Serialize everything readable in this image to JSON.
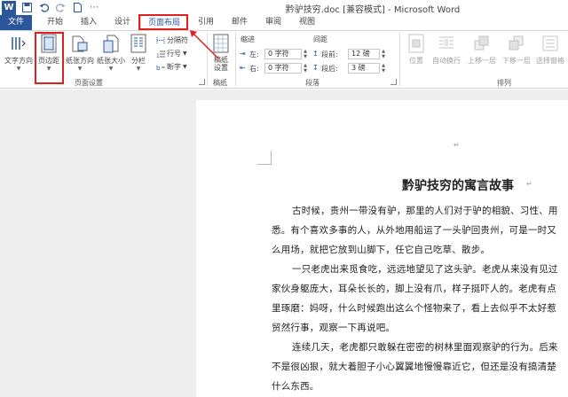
{
  "window": {
    "title": "黔驴技穷.doc [兼容模式] - Microsoft Word"
  },
  "qat": {
    "app_icon": "W",
    "more": "⋯"
  },
  "tabs": [
    "文件",
    "开始",
    "插入",
    "设计",
    "页面布局",
    "引用",
    "邮件",
    "审阅",
    "视图"
  ],
  "active_tab": "页面布局",
  "ribbon": {
    "page_setup": {
      "label": "页面设置",
      "text_direction": "文字方向",
      "margins": "页边距",
      "orientation": "纸张方向",
      "size": "纸张大小",
      "columns": "分栏",
      "breaks": "分隔符",
      "line_numbers": "行号",
      "hyphenation": "断字"
    },
    "draft": {
      "label": "稿纸",
      "settings": "稿纸\n设置"
    },
    "paragraph": {
      "label": "段落",
      "indent_header": "缩进",
      "spacing_header": "间距",
      "left_label": "左:",
      "left_value": "0 字符",
      "right_label": "右:",
      "right_value": "0 字符",
      "before_label": "段前:",
      "before_value": "12 磅",
      "after_label": "段后:",
      "after_value": "3 磅"
    },
    "arrange": {
      "label": "排列",
      "position": "位置",
      "wrap_text": "自动换行",
      "bring_forward": "上移一层",
      "send_backward": "下移一层",
      "selection_pane": "选择窗格"
    }
  },
  "document": {
    "title": "黔驴技穷的寓言故事",
    "lines": [
      "古时候，贵州一带没有驴，那里的人们对于驴的相貌、习性、用",
      "悉。有个喜欢多事的人，从外地用船运了一头驴回贵州，可是一时又",
      "么用场，就把它放到山脚下，任它自己吃草、散步。",
      "一只老虎出来觅食吃，远远地望见了这头驴。老虎从来没有见过",
      "家伙身躯庞大，耳朵长长的，脚上没有爪，样子挺吓人的。老虎有点",
      "里琢磨：妈呀，什么时候跑出这么个怪物来了，看上去似乎不太好惹",
      "贸然行事，观察一下再说吧。",
      "连续几天，老虎都只敢躲在密密的树林里面观察驴的行为。后来",
      "不是很凶狠，就大着胆子小心翼翼地慢慢靠近它，但还是没有搞清楚",
      "什么东西。"
    ]
  },
  "colors": {
    "accent": "#2b579a",
    "highlight": "#e02020"
  }
}
